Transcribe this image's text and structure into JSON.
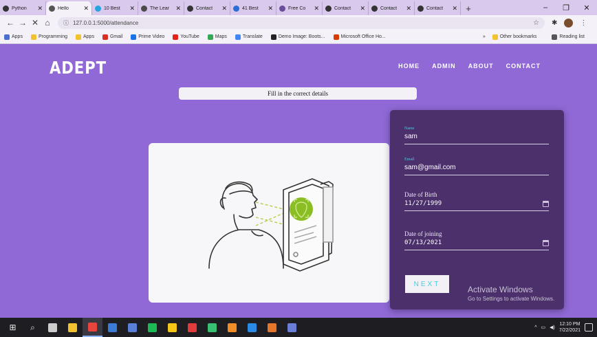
{
  "browser": {
    "tabs": [
      {
        "label": "Python",
        "color": "#333333"
      },
      {
        "label": "Hello",
        "color": "#555555",
        "active": true
      },
      {
        "label": "10 Best",
        "color": "#29a3e0"
      },
      {
        "label": "The Lear",
        "color": "#4b4b4b"
      },
      {
        "label": "Contact",
        "color": "#333333"
      },
      {
        "label": "41 Best",
        "color": "#2b6fd6"
      },
      {
        "label": "Free Co",
        "color": "#6b4c9a"
      },
      {
        "label": "Contact",
        "color": "#333333"
      },
      {
        "label": "Contact",
        "color": "#333333"
      },
      {
        "label": "Contact",
        "color": "#333333"
      }
    ],
    "new_tab": "+",
    "window_controls": {
      "minimize": "–",
      "restore": "❐",
      "close": "✕"
    },
    "url": "127.0.0.1:5000/attendance",
    "nav": {
      "back": "←",
      "forward": "→",
      "reload": "✕",
      "home": "⌂"
    },
    "bookmarks": [
      {
        "label": "Apps",
        "color": "#4a6fd0"
      },
      {
        "label": "Programming",
        "color": "#f2c230"
      },
      {
        "label": "Apps",
        "color": "#f2c230"
      },
      {
        "label": "Gmail",
        "color": "#d93025"
      },
      {
        "label": "Prime Video",
        "color": "#1a73e8"
      },
      {
        "label": "YouTube",
        "color": "#e62117"
      },
      {
        "label": "Maps",
        "color": "#34a853"
      },
      {
        "label": "Translate",
        "color": "#4285f4"
      },
      {
        "label": "Demo Image: Boots...",
        "color": "#222222"
      },
      {
        "label": "Microsoft Office Ho...",
        "color": "#d83b01"
      }
    ],
    "bookmarks_more": "»",
    "other_bookmarks": "Other bookmarks",
    "reading_list": "Reading list"
  },
  "site": {
    "logo": "ADEPT",
    "nav": [
      "HOME",
      "ADMIN",
      "ABOUT",
      "CONTACT"
    ],
    "notice": "Fill in the correct details"
  },
  "form": {
    "name": {
      "label": "Name",
      "value": "sam"
    },
    "email": {
      "label": "Email",
      "value": "sam@gmail.com"
    },
    "dob": {
      "label": "Date of Birth",
      "value": "11/27/1999"
    },
    "doj": {
      "label": "Date of joining",
      "value": "07/13/2021"
    },
    "next_label": "NEXT"
  },
  "watermark": {
    "line1": "Activate Windows",
    "line2": "Go to Settings to activate Windows."
  },
  "taskbar": {
    "start": "⊞",
    "search": "⌕",
    "apps": [
      {
        "name": "task-view",
        "color": "#cccccc"
      },
      {
        "name": "file-explorer",
        "color": "#f2c230"
      },
      {
        "name": "chrome",
        "color": "#e8453c",
        "active": true
      },
      {
        "name": "app-blue",
        "color": "#3a7bd5"
      },
      {
        "name": "app-calc",
        "color": "#5a7fd6"
      },
      {
        "name": "spotify",
        "color": "#1db954"
      },
      {
        "name": "app-star",
        "color": "#f5c518"
      },
      {
        "name": "app-red",
        "color": "#e23b3b"
      },
      {
        "name": "app-green",
        "color": "#38c172"
      },
      {
        "name": "app-orange",
        "color": "#f28c28"
      },
      {
        "name": "vscode",
        "color": "#2a8ae6"
      },
      {
        "name": "app-n",
        "color": "#e6762a"
      },
      {
        "name": "app-img",
        "color": "#6b7fd6"
      }
    ],
    "time": "12:10 PM",
    "date": "7/22/2021"
  }
}
